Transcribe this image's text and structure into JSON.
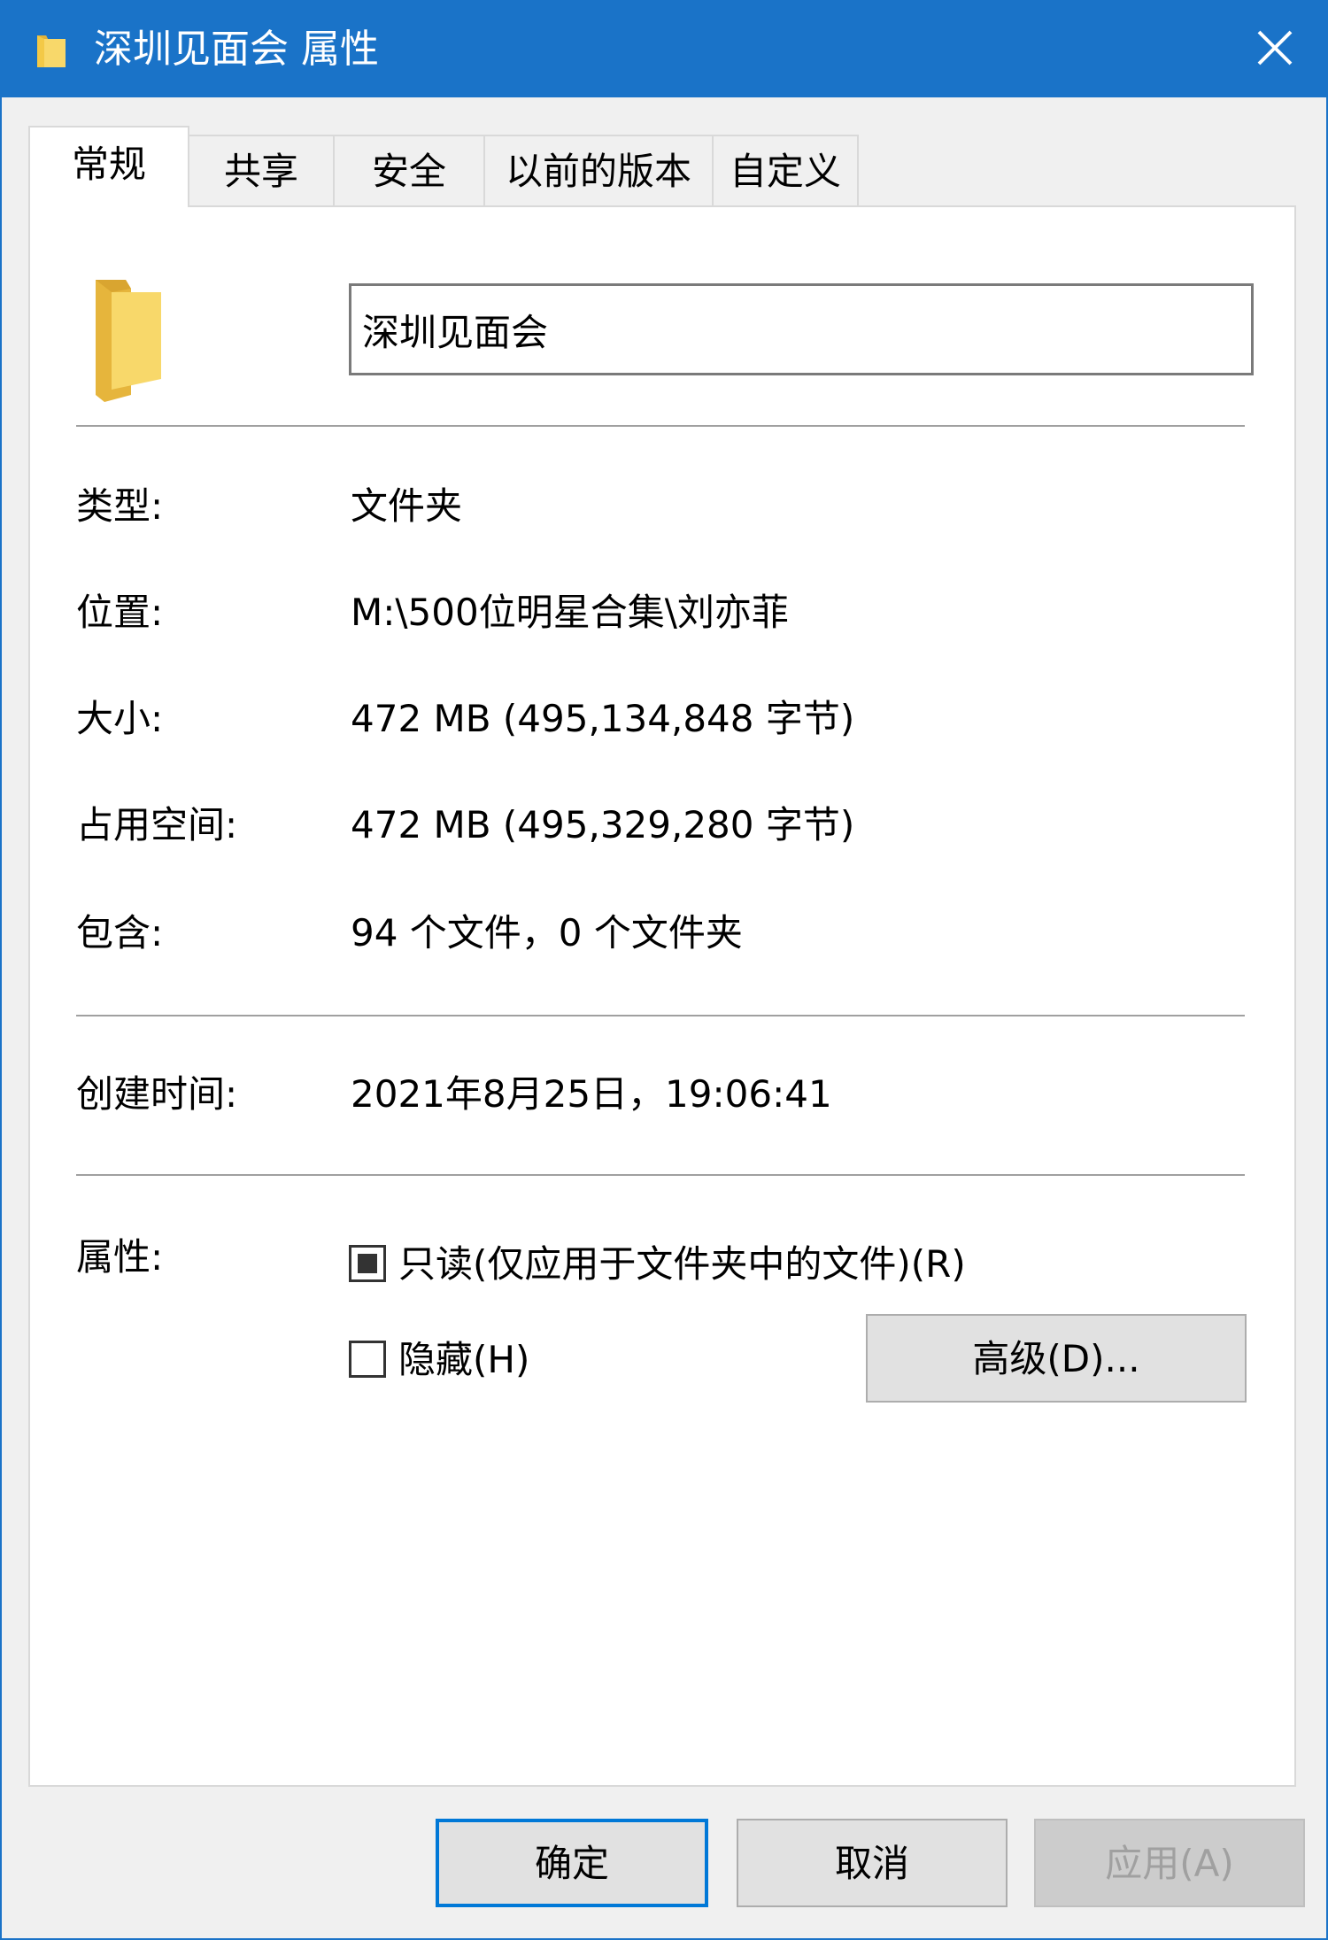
{
  "window": {
    "title": "深圳见面会 属性",
    "title_icon": "folder-icon",
    "close_icon": "close-icon"
  },
  "tabs": [
    {
      "label": "常规",
      "active": true
    },
    {
      "label": "共享",
      "active": false
    },
    {
      "label": "安全",
      "active": false
    },
    {
      "label": "以前的版本",
      "active": false
    },
    {
      "label": "自定义",
      "active": false
    }
  ],
  "general": {
    "name_value": "深圳见面会",
    "type_label": "类型:",
    "type_value": "文件夹",
    "location_label": "位置:",
    "location_value": "M:\\500位明星合集\\刘亦菲",
    "size_label": "大小:",
    "size_value": "472 MB (495,134,848 字节)",
    "size_on_disk_label": "占用空间:",
    "size_on_disk_value": "472 MB (495,329,280 字节)",
    "contains_label": "包含:",
    "contains_value": "94 个文件，0 个文件夹",
    "created_label": "创建时间:",
    "created_value": "2021年8月25日，19:06:41",
    "attributes_label": "属性:",
    "readonly_label": "只读(仅应用于文件夹中的文件)(R)",
    "readonly_state": "indeterminate",
    "hidden_label": "隐藏(H)",
    "hidden_state": "unchecked",
    "advanced_button": "高级(D)..."
  },
  "footer": {
    "ok": "确定",
    "cancel": "取消",
    "apply": "应用(A)"
  },
  "colors": {
    "title_bar": "#1a73c8",
    "primary_button_border": "#0078d7",
    "folder_yellow": "#f3c947"
  }
}
